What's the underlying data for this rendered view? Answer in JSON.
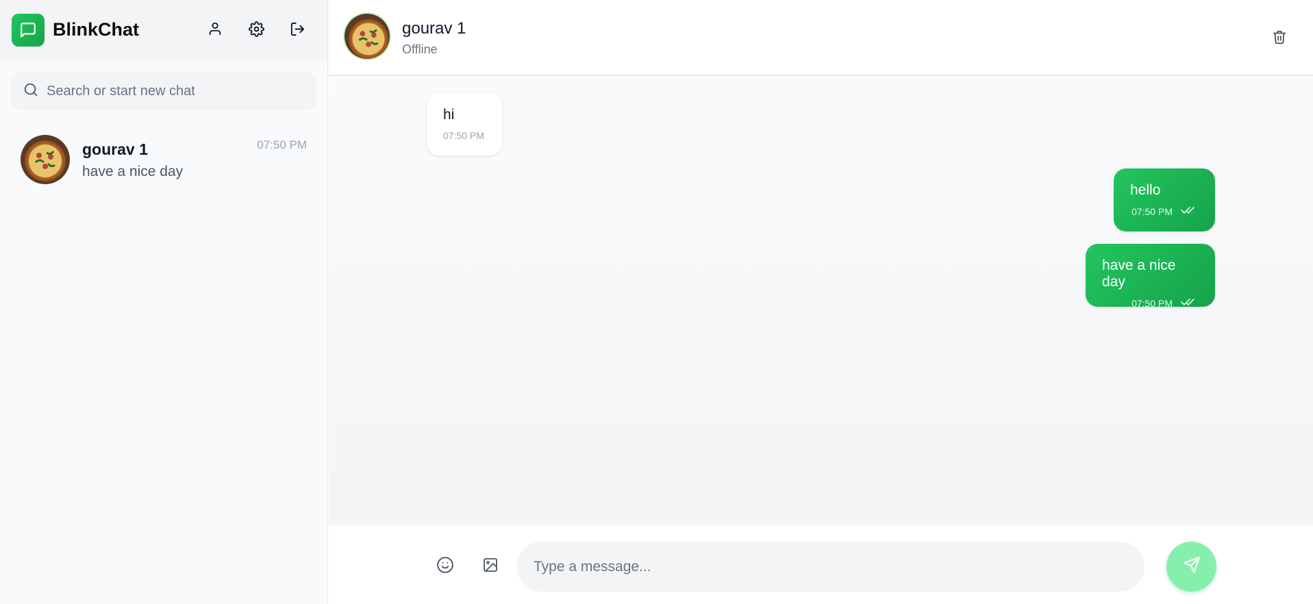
{
  "app": {
    "name": "BlinkChat",
    "brand_color": "#22c55e",
    "logo_icon": "chat-bubble-icon"
  },
  "sidebar": {
    "header_icons": [
      "user-icon",
      "gear-icon",
      "logout-icon"
    ],
    "search": {
      "placeholder": "Search or start new chat",
      "value": ""
    },
    "chats": [
      {
        "name": "gourav 1",
        "last_message": "have a nice day",
        "time": "07:50 PM",
        "avatar": "pizza-image"
      }
    ]
  },
  "conversation": {
    "contact": {
      "name": "gourav 1",
      "status": "Offline",
      "avatar": "pizza-image"
    },
    "header_icons": [
      "trash-icon"
    ],
    "messages": [
      {
        "direction": "incoming",
        "text": "hi",
        "time": "07:50 PM"
      },
      {
        "direction": "outgoing",
        "text": "hello",
        "time": "07:50 PM",
        "status": "read"
      },
      {
        "direction": "outgoing",
        "text": "have a nice day",
        "time": "07:50 PM",
        "status": "read"
      }
    ]
  },
  "composer": {
    "placeholder": "Type a message...",
    "value": "",
    "icons": [
      "emoji-icon",
      "image-icon",
      "send-icon"
    ]
  }
}
